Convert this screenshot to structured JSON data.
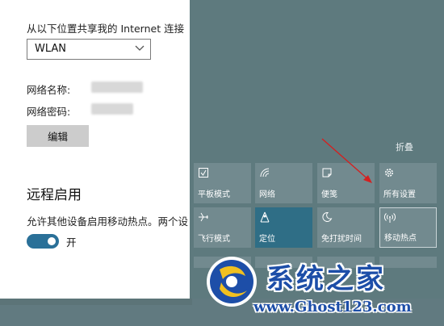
{
  "settings": {
    "share_label": "从以下位置共享我的 Internet 连接",
    "share_select_value": "WLAN",
    "network_name_label": "网络名称:",
    "network_password_label": "网络密码:",
    "edit_button": "编辑",
    "remote_title": "远程启用",
    "remote_desc": "允许其他设备启用移动热点。两个设",
    "toggle_label": "开",
    "toggle_on": true
  },
  "action_center": {
    "collapse_label": "折叠",
    "tiles": [
      {
        "label": "平板模式",
        "icon": "tablet-mode-icon",
        "active": false
      },
      {
        "label": "网络",
        "icon": "network-icon",
        "active": false
      },
      {
        "label": "便笺",
        "icon": "note-icon",
        "active": false
      },
      {
        "label": "所有设置",
        "icon": "gear-icon",
        "active": false
      },
      {
        "label": "飞行模式",
        "icon": "airplane-icon",
        "active": false
      },
      {
        "label": "定位",
        "icon": "location-icon",
        "active": true
      },
      {
        "label": "免打扰时间",
        "icon": "moon-icon",
        "active": false
      },
      {
        "label": "移动热点",
        "icon": "hotspot-icon",
        "active": false
      }
    ]
  },
  "colors": {
    "accent_blue": "#2a7098",
    "tile_bg": "#728a8f",
    "tile_active_bg": "#2f6e86",
    "action_center_bg": "#5e7a7e",
    "arrow_red": "#d42020"
  },
  "watermark": {
    "title": "系统之家",
    "url": "www.Ghost123.com"
  }
}
